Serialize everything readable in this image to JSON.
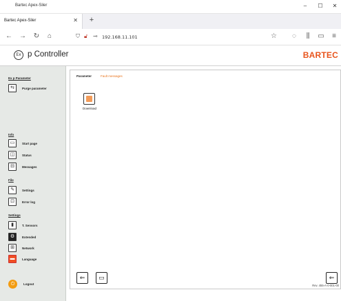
{
  "window": {
    "title": "Bartec Apex-Siler",
    "minimize": "–",
    "maximize": "☐",
    "close": "✕"
  },
  "browser": {
    "tab_label": "Bartec Apex-Siler",
    "tab_close": "✕",
    "new_tab": "+",
    "url": "192.168.11.101",
    "icons": {
      "back": "←",
      "forward": "→",
      "reload": "↻",
      "home": "⌂",
      "star": "☆",
      "pocket": "◌",
      "library": "⫼",
      "sidebar": "▭",
      "menu": "≡"
    }
  },
  "app": {
    "ex_logo": "Ex",
    "title": "p Controller",
    "brand": "BARTEC",
    "brand_color": "#e8541c"
  },
  "sidebar": {
    "sections": [
      {
        "heading": "Ex p Parameter",
        "items": [
          {
            "label": "Purge parameter",
            "icon": "purge-parameter-icon"
          }
        ]
      },
      {
        "heading": "Info",
        "items": [
          {
            "label": "Start page",
            "icon": "start-page-icon"
          },
          {
            "label": "Status",
            "icon": "status-icon"
          },
          {
            "label": "Messages",
            "icon": "messages-icon"
          }
        ]
      },
      {
        "heading": "File",
        "items": [
          {
            "label": "Settings",
            "icon": "settings-icon"
          },
          {
            "label": "Error log",
            "icon": "error-log-icon"
          }
        ]
      },
      {
        "heading": "Settings",
        "items": [
          {
            "label": "T. Sensors",
            "icon": "temperature-sensor-icon"
          },
          {
            "label": "Extended",
            "icon": "extended-icon"
          },
          {
            "label": "Network",
            "icon": "network-icon"
          },
          {
            "label": "Language",
            "icon": "language-flag-icon"
          }
        ]
      }
    ],
    "logout_label": "Logout"
  },
  "main": {
    "tabs": [
      {
        "label": "Parameter",
        "active": true
      },
      {
        "label": "Fault messages",
        "active": false
      }
    ],
    "download_label": "Download",
    "revision": "Rev. 455-A-0-001-00"
  }
}
